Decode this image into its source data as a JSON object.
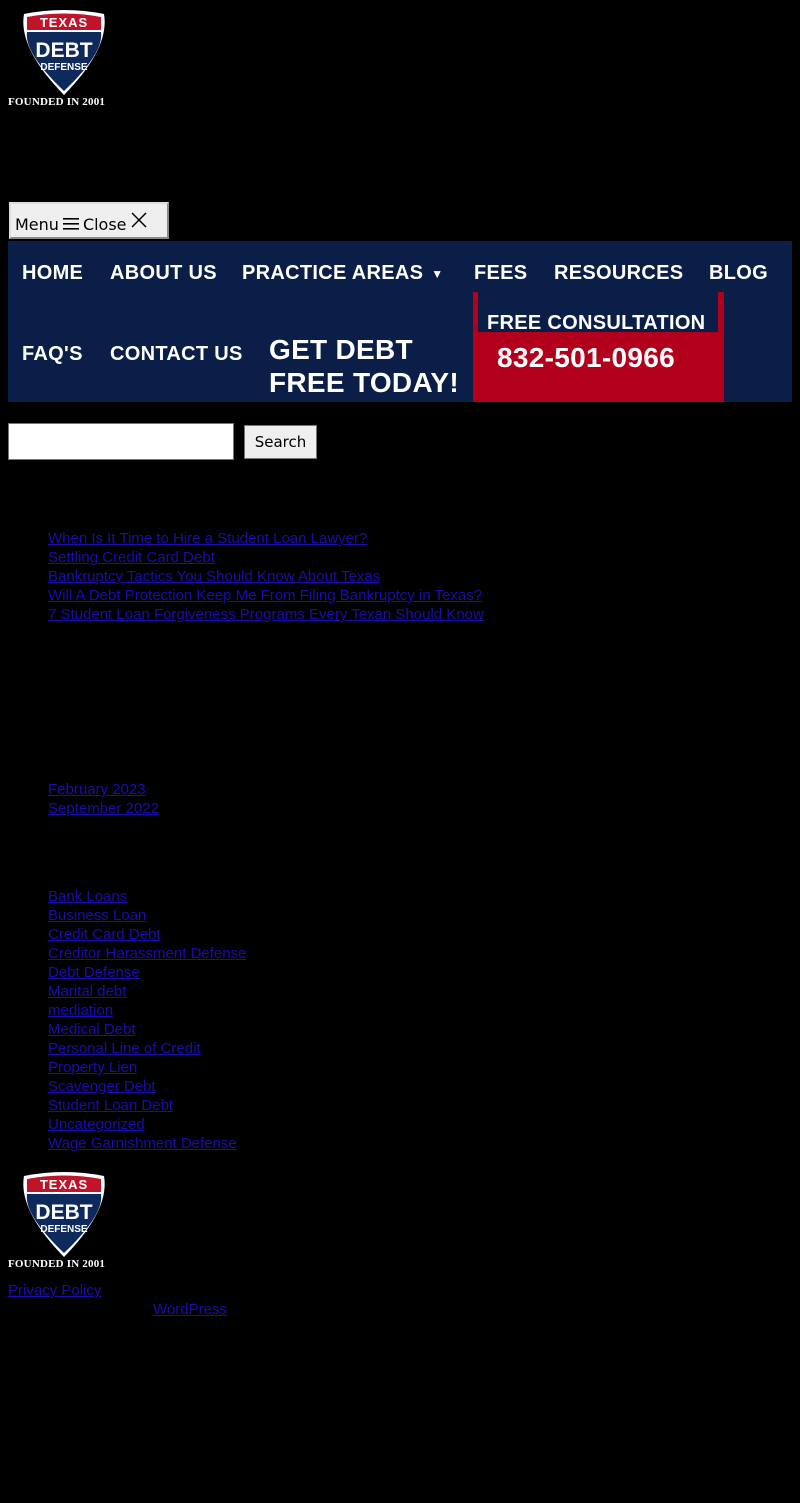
{
  "header": {
    "logo": {
      "top_text": "TEXAS",
      "main_text": "DEBT",
      "sub_text": "DEFENSE",
      "tagline": "FOUNDED IN 2001"
    },
    "menu_toggle": {
      "menu_label": "Menu",
      "close_label": "Close"
    }
  },
  "nav": {
    "items": [
      {
        "label": "HOME"
      },
      {
        "label": "ABOUT US"
      },
      {
        "label": "PRACTICE AREAS"
      },
      {
        "label": "FEES"
      },
      {
        "label": "RESOURCES"
      },
      {
        "label": "BLOG"
      },
      {
        "label": "FAQ'S"
      },
      {
        "label": "CONTACT US"
      }
    ],
    "cta": {
      "headline_line1": "GET DEBT",
      "headline_line2": "FREE TODAY!",
      "label": "FREE CONSULTATION",
      "phone": "832-501-0966"
    }
  },
  "search": {
    "button_label": "Search",
    "value": ""
  },
  "recent_posts": [
    "When Is It Time to Hire a Student Loan Lawyer?",
    "Settling Credit Card Debt",
    "Bankruptcy Tactics You Should Know About Texas",
    "Will A Debt Protection Keep Me From Filing Bankruptcy in Texas?",
    "7 Student Loan Forgiveness Programs Every Texan Should Know"
  ],
  "archives": [
    "February 2023",
    "September 2022"
  ],
  "categories": [
    "Bank Loans",
    "Business Loan",
    "Credit Card Debt",
    "Creditor Harassment Defense",
    "Debt Defense",
    "Marital debt",
    "mediation",
    "Medical Debt",
    "Personal Line of Credit",
    "Property Lien",
    "Scavenger Debt",
    "Student Loan Debt",
    "Uncategorized",
    "Wage Garnishment Defense"
  ],
  "footer": {
    "logo": {
      "top_text": "TEXAS",
      "main_text": "DEBT",
      "sub_text": "DEFENSE",
      "tagline": "FOUNDED IN 2001"
    },
    "privacy_label": "Privacy Policy",
    "wordpress_label": "WordPress"
  },
  "colors": {
    "background": "#000000",
    "nav_bg": "#0b1e47",
    "cta_red": "#b2001c",
    "link": "#1a0dab"
  }
}
